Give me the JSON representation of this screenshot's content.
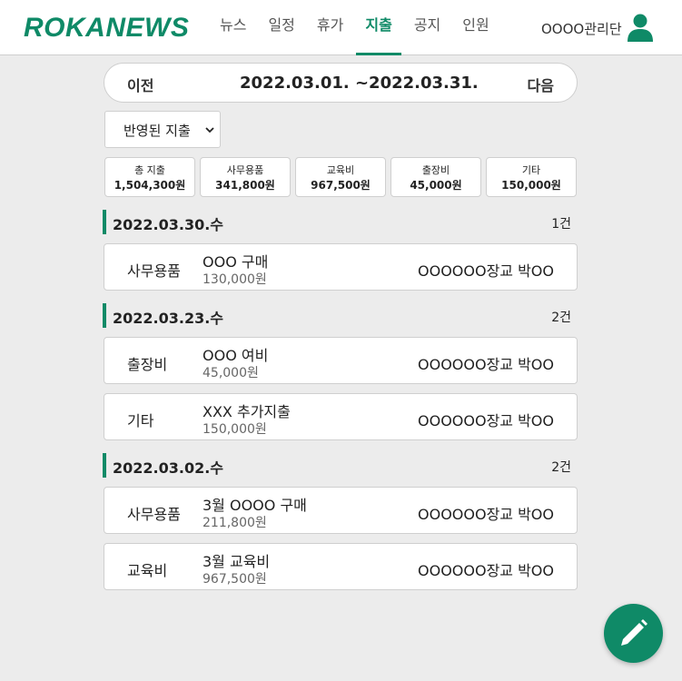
{
  "header": {
    "logo": "ROKANEWS",
    "nav": [
      "뉴스",
      "일정",
      "휴가",
      "지출",
      "공지",
      "인원"
    ],
    "active_nav": "지출",
    "user_name": "OOOO관리단"
  },
  "period": {
    "prev_label": "이전",
    "next_label": "다음",
    "range": "2022.03.01. ~2022.03.31."
  },
  "filter": {
    "selected": "반영된 지출"
  },
  "summary": [
    {
      "label": "총 지출",
      "amount": "1,504,300원"
    },
    {
      "label": "사무용품",
      "amount": "341,800원"
    },
    {
      "label": "교육비",
      "amount": "967,500원"
    },
    {
      "label": "출장비",
      "amount": "45,000원"
    },
    {
      "label": "기타",
      "amount": "150,000원"
    }
  ],
  "groups": [
    {
      "date": "2022.03.30.수",
      "count": "1건",
      "items": [
        {
          "category": "사무용품",
          "title": "OOO 구매",
          "amount": "130,000원",
          "person": "OOOOOO장교 박OO"
        }
      ]
    },
    {
      "date": "2022.03.23.수",
      "count": "2건",
      "items": [
        {
          "category": "출장비",
          "title": "OOO 여비",
          "amount": "45,000원",
          "person": "OOOOOO장교 박OO"
        },
        {
          "category": "기타",
          "title": "XXX 추가지출",
          "amount": "150,000원",
          "person": "OOOOOO장교 박OO"
        }
      ]
    },
    {
      "date": "2022.03.02.수",
      "count": "2건",
      "items": [
        {
          "category": "사무용품",
          "title": "3월 OOOO 구매",
          "amount": "211,800원",
          "person": "OOOOOO장교 박OO"
        },
        {
          "category": "교육비",
          "title": "3월 교육비",
          "amount": "967,500원",
          "person": "OOOOOO장교 박OO"
        }
      ]
    }
  ],
  "fab_icon": "pencil-icon",
  "colors": {
    "accent": "#0f8a67",
    "background": "#ececec",
    "border": "#cfcfcf"
  }
}
